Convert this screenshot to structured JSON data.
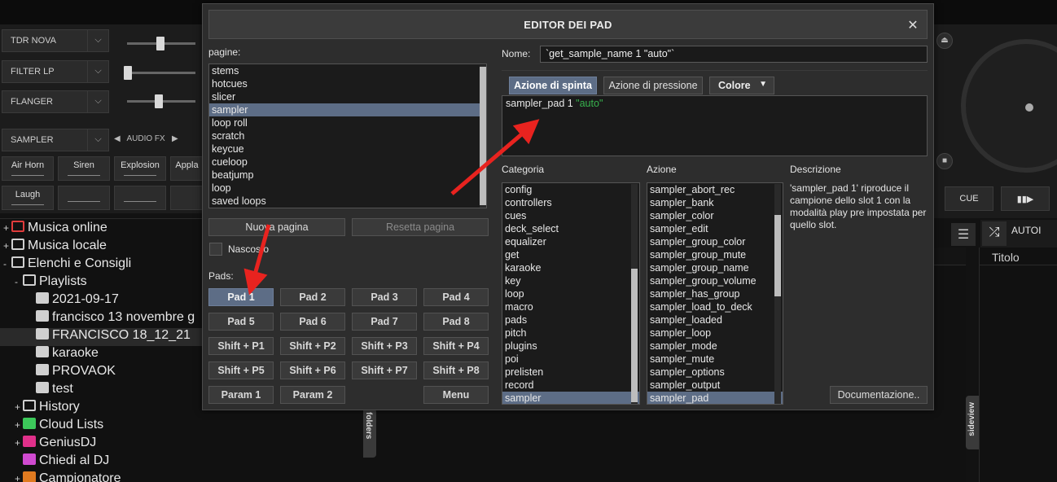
{
  "background": {
    "fx": {
      "effects": [
        "TDR NOVA",
        "FILTER LP",
        "FLANGER"
      ],
      "sampler_select": "SAMPLER",
      "audio_fx_label": "AUDIO FX",
      "sampler_buttons": [
        "Air Horn",
        "Siren",
        "Explosion",
        "Appla",
        "Laugh"
      ]
    },
    "tree": {
      "items": [
        {
          "label": "Musica online",
          "pm": "+",
          "color": "#e03c3c"
        },
        {
          "label": "Musica locale",
          "pm": "+",
          "color": "#d0d0d0"
        },
        {
          "label": "Elenchi e Consigli",
          "pm": "-",
          "color": "#d0d0d0"
        },
        {
          "label": "Playlists",
          "pm": "-",
          "color": "#d0d0d0"
        },
        {
          "label": "2021-09-17",
          "pm": "",
          "color": "#d0d0d0"
        },
        {
          "label": "francisco 13 novembre g",
          "pm": "",
          "color": "#d0d0d0"
        },
        {
          "label": "FRANCISCO 18_12_21",
          "pm": "",
          "color": "#d0d0d0"
        },
        {
          "label": "karaoke",
          "pm": "",
          "color": "#d0d0d0"
        },
        {
          "label": "PROVAOK",
          "pm": "",
          "color": "#d0d0d0"
        },
        {
          "label": "test",
          "pm": "",
          "color": "#d0d0d0"
        },
        {
          "label": "History",
          "pm": "+",
          "color": "#d0d0d0"
        },
        {
          "label": "Cloud Lists",
          "pm": "+",
          "color": "#3cc85a"
        },
        {
          "label": "GeniusDJ",
          "pm": "+",
          "color": "#e0308a"
        },
        {
          "label": "Chiedi al DJ",
          "pm": "",
          "color": "#d04ad0"
        },
        {
          "label": "Campionatore",
          "pm": "+",
          "color": "#e07a20"
        }
      ]
    },
    "folders_tab": "folders",
    "sideview_tab": "sideview",
    "cue_label": "CUE",
    "play_label": "▮▮▶",
    "automix_label": "AUTOI",
    "titolo_header": "Titolo"
  },
  "dialog": {
    "title": "EDITOR DEI PAD",
    "close": "✕",
    "pages_label": "pagine:",
    "pages": [
      "stems",
      "hotcues",
      "slicer",
      "sampler",
      "loop roll",
      "scratch",
      "keycue",
      "cueloop",
      "beatjump",
      "loop",
      "saved loops",
      "..."
    ],
    "pages_selected": "sampler",
    "new_page": "Nuova pagina",
    "reset_page": "Resetta pagina",
    "hidden_label": "Nascosto",
    "pads_label": "Pads:",
    "pads": [
      [
        "Pad 1",
        "Pad 2",
        "Pad 3",
        "Pad 4"
      ],
      [
        "Pad 5",
        "Pad 6",
        "Pad 7",
        "Pad 8"
      ],
      [
        "Shift + P1",
        "Shift + P2",
        "Shift + P3",
        "Shift + P4"
      ],
      [
        "Shift + P5",
        "Shift + P6",
        "Shift + P7",
        "Shift + P8"
      ]
    ],
    "param1": "Param 1",
    "param2": "Param 2",
    "menu": "Menu",
    "name_label": "Nome:",
    "name_value": "`get_sample_name 1 \"auto\"`",
    "tabs": {
      "press": "Azione di spinta",
      "hold": "Azione di pressione",
      "color": "Colore"
    },
    "script": {
      "cmd": "sampler_pad 1 ",
      "arg": "\"auto\""
    },
    "category_label": "Categoria",
    "categories": [
      "config",
      "controllers",
      "cues",
      "deck_select",
      "equalizer",
      "get",
      "karaoke",
      "key",
      "loop",
      "macro",
      "pads",
      "pitch",
      "plugins",
      "poi",
      "prelisten",
      "record",
      "sampler"
    ],
    "category_selected": "sampler",
    "action_label": "Azione",
    "actions": [
      "sampler_abort_rec",
      "sampler_bank",
      "sampler_color",
      "sampler_edit",
      "sampler_group_color",
      "sampler_group_mute",
      "sampler_group_name",
      "sampler_group_volume",
      "sampler_has_group",
      "sampler_load_to_deck",
      "sampler_loaded",
      "sampler_loop",
      "sampler_mode",
      "sampler_mute",
      "sampler_options",
      "sampler_output",
      "sampler_pad"
    ],
    "action_selected": "sampler_pad",
    "description_label": "Descrizione",
    "description": "'sampler_pad 1' riproduce il campione dello slot 1 con la modalità play pre impostata per quello slot.",
    "doc_button": "Documentazione..",
    "colors": {
      "accent": "#5d6d86",
      "arrow": "#e8231f",
      "string": "#37b24d"
    }
  }
}
